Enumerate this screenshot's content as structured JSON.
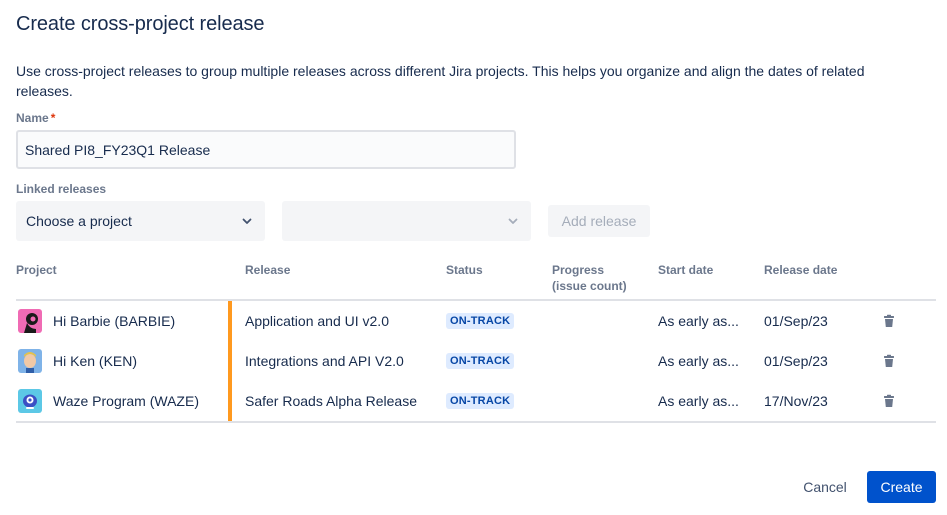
{
  "dialog": {
    "title": "Create cross-project release",
    "description": "Use cross-project releases to group multiple releases across different Jira projects. This helps you organize and align the dates of related releases."
  },
  "form": {
    "name_label": "Name",
    "required_marker": "*",
    "name_value": "Shared PI8_FY23Q1 Release",
    "linked_label": "Linked releases",
    "project_select_placeholder": "Choose a project",
    "release_select_placeholder": "",
    "add_release_label": "Add release"
  },
  "table": {
    "headers": {
      "project": "Project",
      "release": "Release",
      "status": "Status",
      "progress_line1": "Progress",
      "progress_line2": "(issue count)",
      "start_date": "Start date",
      "release_date": "Release date"
    },
    "rows": [
      {
        "project": "Hi Barbie (BARBIE)",
        "avatar": "barbie-avatar-icon",
        "release": "Application and UI v2.0",
        "status": "ON-TRACK",
        "progress": "",
        "start_date": "As early as...",
        "release_date": "01/Sep/23"
      },
      {
        "project": "Hi Ken (KEN)",
        "avatar": "ken-avatar-icon",
        "release": "Integrations and API V2.0",
        "status": "ON-TRACK",
        "progress": "",
        "start_date": "As early as...",
        "release_date": "01/Sep/23"
      },
      {
        "project": "Waze Program (WAZE)",
        "avatar": "waze-avatar-icon",
        "release": "Safer Roads Alpha Release",
        "status": "ON-TRACK",
        "progress": "",
        "start_date": "As early as...",
        "release_date": "17/Nov/23"
      }
    ]
  },
  "footer": {
    "cancel_label": "Cancel",
    "create_label": "Create"
  },
  "colors": {
    "primary": "#0052CC",
    "accent_bar": "#FF991F",
    "status_bg": "#DEEBFF",
    "status_text": "#0747A6"
  }
}
